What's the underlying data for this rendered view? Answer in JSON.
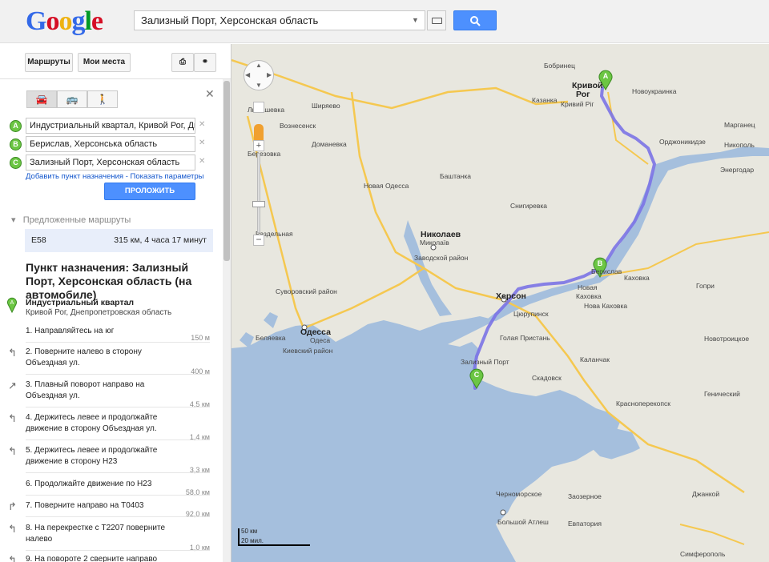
{
  "header": {
    "search_value": "Зализный Порт, Херсонская область"
  },
  "panel": {
    "tab_routes": "Маршруты",
    "tab_my_places": "Мои места",
    "waypoints": [
      {
        "letter": "A",
        "value": "Индустриальный квартал, Кривой Рог, Днеп"
      },
      {
        "letter": "B",
        "value": "Берислав, Херсонська область"
      },
      {
        "letter": "C",
        "value": "Зализный Порт, Херсонская область"
      }
    ],
    "add_destination": "Добавить пункт назначения",
    "show_options": "Показать параметры",
    "extend_route": "ПРОЛОЖИТЬ МАРШРУТ",
    "suggested_routes": "Предложенные маршруты",
    "route": {
      "name": "E58",
      "summary": "315 км, 4 часа 17 минут"
    },
    "destination_title": "Пункт назначения: Зализный Порт, Херсонская область (на автомобиле)",
    "start": {
      "letter": "A",
      "name": "Индустриальный квартал",
      "address": "Кривой Рог, Днепропетровская область"
    },
    "steps": [
      {
        "icon": "straight",
        "text": "1. Направляйтесь на юг",
        "dist": "150 м"
      },
      {
        "icon": "left",
        "text": "2. Поверните налево в сторону Объездная ул.",
        "dist": "400 м"
      },
      {
        "icon": "slight-right",
        "text": "3. Плавный поворот направо на Объездная ул.",
        "dist": "4,5 км"
      },
      {
        "icon": "left",
        "text": "4. Держитесь левее и продолжайте движение в сторону Объездная ул.",
        "dist": "1,4 км"
      },
      {
        "icon": "left",
        "text": "5. Держитесь левее и продолжайте движение в сторону Н23",
        "dist": "3,3 км"
      },
      {
        "icon": "none",
        "text": "6. Продолжайте движение по Н23",
        "dist": "58,0 км"
      },
      {
        "icon": "right",
        "text": "7. Поверните направо на Т0403",
        "dist": "92,0 км"
      },
      {
        "icon": "left",
        "text": "8. На перекрестке с Т2207 поверните налево",
        "dist": "1,0 км"
      },
      {
        "icon": "left",
        "text": "9. На повороте 2 сверните направо",
        "dist": ""
      }
    ]
  },
  "map": {
    "scale_km": "50 км",
    "scale_mi": "20 мил.",
    "markers": [
      "A",
      "B",
      "C"
    ],
    "labels": [
      {
        "t": "Кривой",
        "b": true
      },
      {
        "t": "Рог",
        "b": true
      },
      {
        "t": "Кривий Ріг"
      },
      {
        "t": "Николаев",
        "b": true
      },
      {
        "t": "Миколаїв"
      },
      {
        "t": "Одесса",
        "b": true
      },
      {
        "t": "Одеса"
      },
      {
        "t": "Херсон",
        "b": true
      },
      {
        "t": "Берислав"
      },
      {
        "t": "Новая"
      },
      {
        "t": "Каховка"
      },
      {
        "t": "Никополь"
      },
      {
        "t": "Орджоникидзе"
      },
      {
        "t": "Марганец"
      },
      {
        "t": "Энергодар"
      },
      {
        "t": "Евпатория"
      },
      {
        "t": "Симферополь"
      },
      {
        "t": "Джанкой"
      },
      {
        "t": "Скадовск"
      },
      {
        "t": "Каланчак"
      },
      {
        "t": "Красноперекопск"
      },
      {
        "t": "Вознесенск"
      },
      {
        "t": "Березовка"
      },
      {
        "t": "Казанка"
      },
      {
        "t": "Снигиревка"
      },
      {
        "t": "Голая Пристань"
      },
      {
        "t": "Цюрупинск"
      },
      {
        "t": "Зализный Порт"
      },
      {
        "t": "Каховка"
      },
      {
        "t": "Нова Каховка"
      },
      {
        "t": "Суворовский район"
      },
      {
        "t": "Киевский район"
      },
      {
        "t": "Заводской район"
      },
      {
        "t": "Доманевка"
      },
      {
        "t": "Новая Одесса"
      },
      {
        "t": "Баштанка"
      },
      {
        "t": "Бобринец"
      },
      {
        "t": "Новоукраинка"
      },
      {
        "t": "Любашевка"
      },
      {
        "t": "Ширяево"
      },
      {
        "t": "Раздельная"
      },
      {
        "t": "Беляевка"
      },
      {
        "t": "Черноморское"
      },
      {
        "t": "Большой Атлеш"
      },
      {
        "t": "Заозерное"
      },
      {
        "t": "Генический"
      },
      {
        "t": "Новотроицкое"
      },
      {
        "t": "Гопри"
      }
    ]
  },
  "colors": {
    "route": "#7b73e6",
    "water": "#a5bfdd",
    "land": "#e8e7df",
    "accent": "#4d90fe"
  }
}
